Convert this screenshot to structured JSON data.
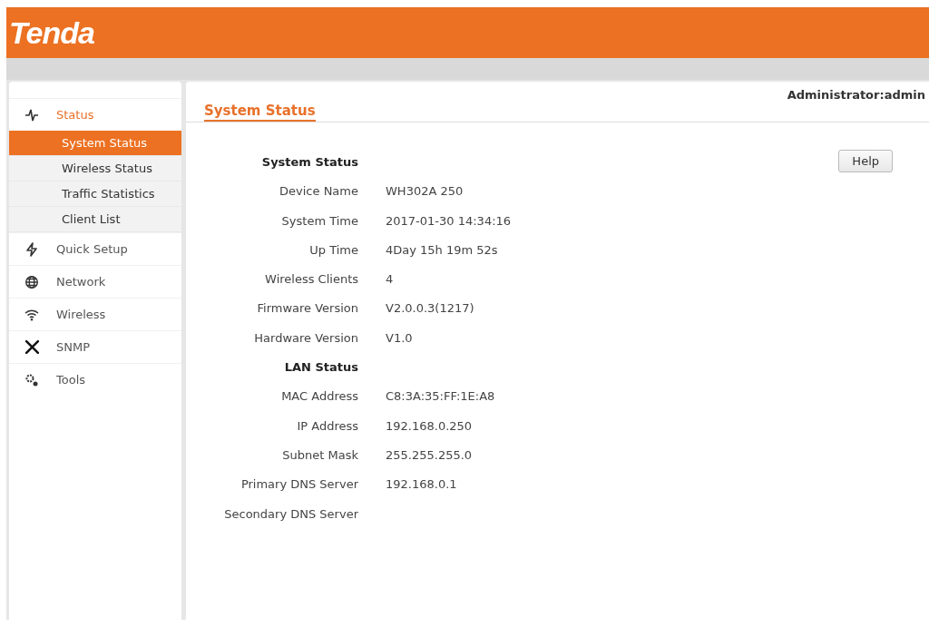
{
  "header": {
    "logo": "Tenda"
  },
  "user": "Administrator:admin",
  "sidebar": {
    "items": [
      {
        "label": "Status",
        "expanded": true,
        "children": [
          {
            "label": "System Status",
            "selected": true
          },
          {
            "label": "Wireless Status",
            "selected": false
          },
          {
            "label": "Traffic Statistics",
            "selected": false
          },
          {
            "label": "Client List",
            "selected": false
          }
        ]
      },
      {
        "label": "Quick Setup",
        "expanded": false
      },
      {
        "label": "Network",
        "expanded": false
      },
      {
        "label": "Wireless",
        "expanded": false
      },
      {
        "label": "SNMP",
        "expanded": false
      },
      {
        "label": "Tools",
        "expanded": false
      }
    ]
  },
  "page_tab": "System Status",
  "help_button": "Help",
  "rows": [
    {
      "kind": "heading",
      "label": "System Status"
    },
    {
      "kind": "field",
      "label": "Device Name",
      "value": "WH302A 250"
    },
    {
      "kind": "field",
      "label": "System Time",
      "value": "2017-01-30 14:34:16"
    },
    {
      "kind": "field",
      "label": "Up Time",
      "value": "4Day 15h 19m 52s"
    },
    {
      "kind": "field",
      "label": "Wireless Clients",
      "value": "4"
    },
    {
      "kind": "field",
      "label": "Firmware Version",
      "value": "V2.0.0.3(1217)"
    },
    {
      "kind": "field",
      "label": "Hardware Version",
      "value": "V1.0"
    },
    {
      "kind": "heading",
      "label": "LAN Status"
    },
    {
      "kind": "field",
      "label": "MAC Address",
      "value": "C8:3A:35:FF:1E:A8"
    },
    {
      "kind": "field",
      "label": "IP Address",
      "value": "192.168.0.250"
    },
    {
      "kind": "field",
      "label": "Subnet Mask",
      "value": "255.255.255.0"
    },
    {
      "kind": "field",
      "label": "Primary DNS Server",
      "value": "192.168.0.1"
    },
    {
      "kind": "field",
      "label": "Secondary DNS Server"
    }
  ]
}
